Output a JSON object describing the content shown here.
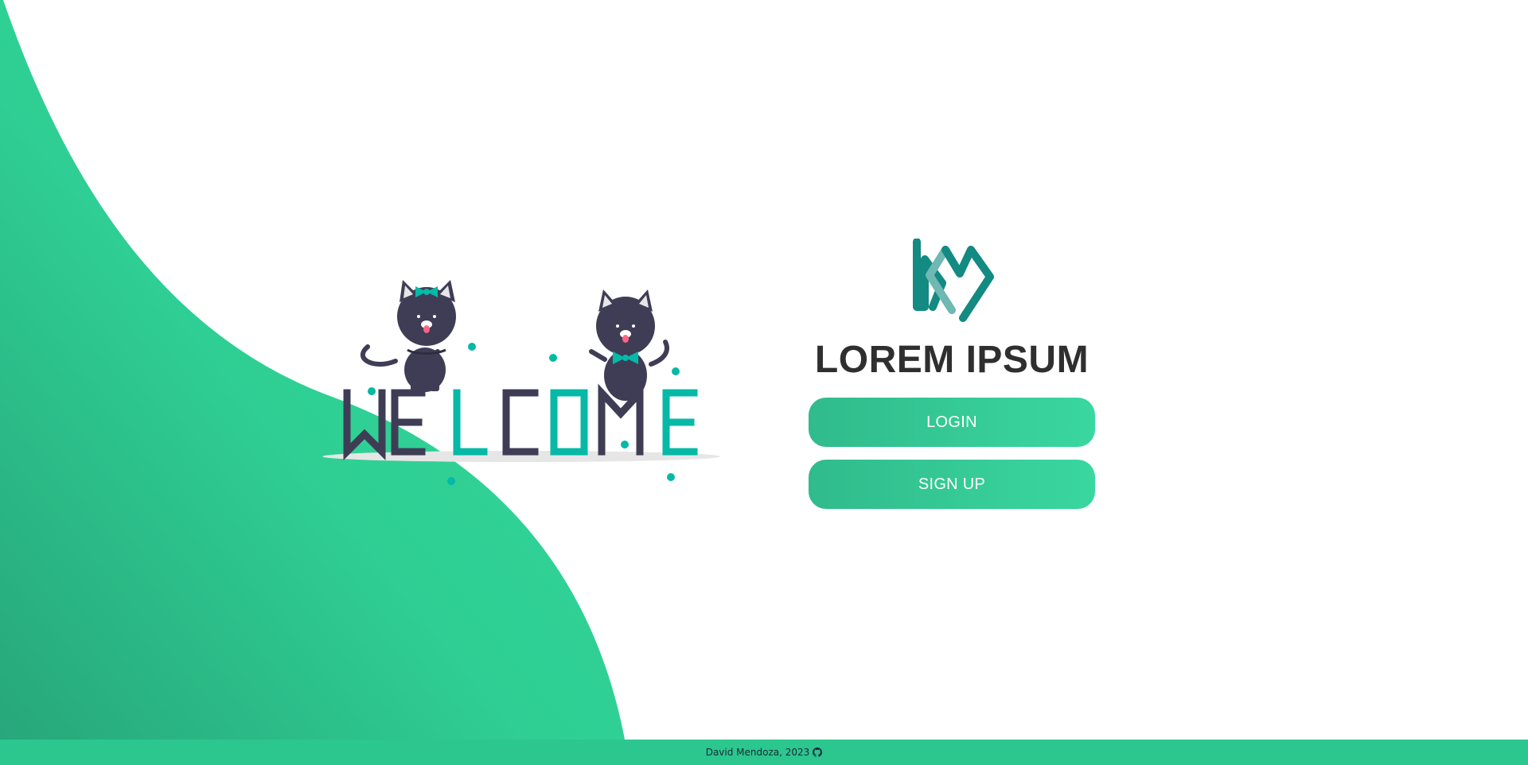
{
  "hero": {
    "welcome_text": "WELCOME",
    "colors": {
      "accent": "#2fd39a",
      "dark": "#3f3d56",
      "teal": "#05b9a6"
    }
  },
  "auth": {
    "title": "LOREM IPSUM",
    "login_label": "LOGIN",
    "signup_label": "SIGN UP"
  },
  "brand": {
    "logo_icon": "km-logo-icon",
    "colors": {
      "primary": "#138a82",
      "secondary": "#6fb8b3"
    }
  },
  "footer": {
    "credit": "David Mendoza, 2023",
    "link_icon": "github-icon",
    "background": "#2cc68f"
  }
}
